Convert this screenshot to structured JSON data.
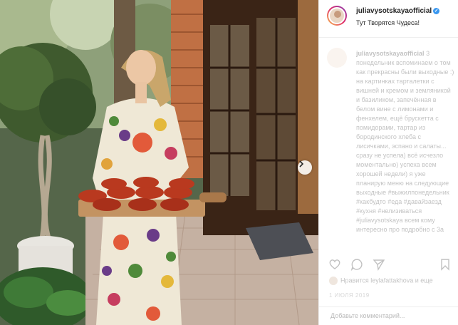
{
  "post": {
    "username": "juliavysotskayaofficial",
    "location": "Тут Творятся Чудеса!",
    "caption_username": "juliavysotskayaofficial",
    "caption_text": "3 понедельник вспоминаем о том как прекрасны были выходные :) на картинках тарталетки с вишней и кремом и земляникой и базиликом, запечённая в белом вине с лимонами и фенхелем, ещё брускетта с помидорами, тартар из бородинского хлеба с лисичками, эспано и салаты... сразу не успела) всё исчезло моментально) успеха всем хорошей недели) я уже планирую меню на следующие выходные #выжилпонедельник #какбудто #еда #давайзаезд #кухня #нелизиваться #juliavysotskaya всем кому интересно про подробно с 3а",
    "likes_text": "Нравится leylafattakhova и еще",
    "date_text": "1 ИЮЛЯ 2019",
    "comment_placeholder": "Добавьте комментарий..."
  },
  "icons": {
    "verified": "verified-badge-icon",
    "next": "chevron-right-icon",
    "like": "heart-icon",
    "comment": "comment-bubble-icon",
    "share": "paper-plane-icon",
    "save": "bookmark-icon"
  },
  "colors": {
    "verified_blue": "#3897f0",
    "text": "#262626",
    "muted": "#8e8e8e",
    "border": "#efefef"
  }
}
